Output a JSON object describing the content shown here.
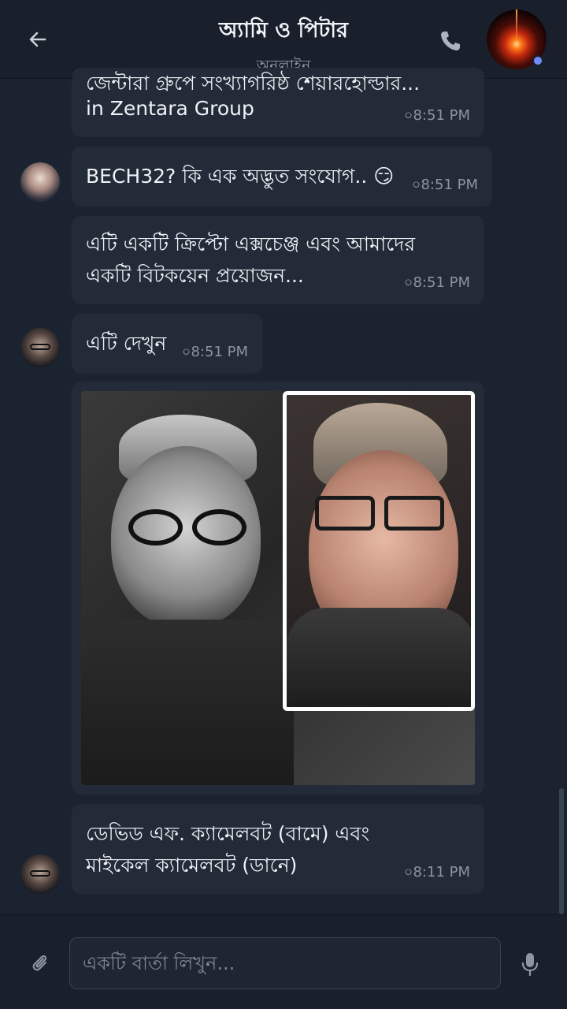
{
  "header": {
    "title": "অ্যামি ও পিটার",
    "status": "অনলাইন",
    "back_icon": "arrow-left-icon",
    "call_icon": "phone-icon"
  },
  "messages": [
    {
      "sender": "peter",
      "text_line1": "জেন্টারা গ্রুপে সংখ্যাগরিষ্ঠ শেয়ারহোল্ডার...",
      "text_line2": "in Zentara Group",
      "time": "০8:51 PM"
    },
    {
      "sender": "amy",
      "text": "BECH32? কি এক অদ্ভুত সংযোগ.. 😏",
      "time": "০8:51 PM"
    },
    {
      "sender": "amy",
      "text_line1": "এটি একটি ক্রিপ্টো এক্সচেঞ্জ এবং আমাদের",
      "text_line2": "একটি বিটকয়েন প্রয়োজন...",
      "time": "০8:51 PM"
    },
    {
      "sender": "peter",
      "text": "এটি দেখুন",
      "time": "০8:51 PM"
    },
    {
      "sender": "peter",
      "type": "image"
    },
    {
      "sender": "peter",
      "text_line1": "ডেভিড এফ. ক্যামেলবট (বামে) এবং",
      "text_line2": "মাইকেল ক্যামেলবট (ডানে)",
      "time": "০8:11 PM"
    }
  ],
  "composer": {
    "placeholder": "একটি বার্তা লিখুন...",
    "attach_icon": "paperclip-icon",
    "mic_icon": "microphone-icon"
  },
  "colors": {
    "background": "#1c2330",
    "bubble": "#242b38",
    "header": "#1a202b",
    "online_dot": "#6e8cff"
  }
}
